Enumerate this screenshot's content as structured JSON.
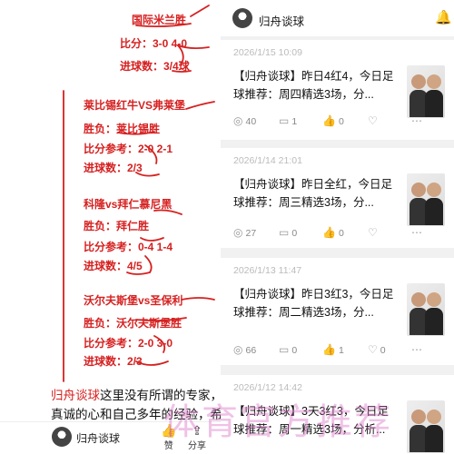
{
  "left": {
    "lines": [
      {
        "text": "国际米兰胜",
        "style": "red"
      },
      {
        "text": "比分：3-0 4-0",
        "style": "red"
      },
      {
        "text": "进球数：3/4球",
        "style": "red"
      },
      {
        "text": "莱比锡红牛VS弗莱堡",
        "style": "red"
      },
      {
        "text": "胜负：莱比锡胜",
        "style": "red"
      },
      {
        "text": "比分参考：2-0 2-1",
        "style": "red"
      },
      {
        "text": "进球数：2/3",
        "style": "red"
      },
      {
        "text": "科隆vs拜仁慕尼黑",
        "style": "red"
      },
      {
        "text": "胜负：拜仁胜",
        "style": "red"
      },
      {
        "text": "比分参考：0-4 1-4",
        "style": "red"
      },
      {
        "text": "进球数：4/5",
        "style": "red"
      },
      {
        "text": "沃尔夫斯堡vs圣保利",
        "style": "red"
      },
      {
        "text": "胜负：沃尔夫斯堡胜",
        "style": "red"
      },
      {
        "text": "比分参考：2-0 3-0",
        "style": "red"
      },
      {
        "text": "进球数：2/3",
        "style": "red"
      }
    ],
    "note_brand": "归舟谈球",
    "note_rest": "这里没有所谓的专家，真诚的心和自己多年的经验，希",
    "bottom_bar": {
      "author": "归舟谈球",
      "like_label": "赞",
      "share_label": "分享"
    }
  },
  "right": {
    "header_name": "归舟谈球",
    "cards": [
      {
        "date": "2026/1/15 10:09",
        "text": "【归舟谈球】昨日4红4，今日足球推荐：周四精选3场，分...",
        "views": "40",
        "comments": "1",
        "likes": "0",
        "shares": ""
      },
      {
        "date": "2026/1/14 21:01",
        "text": "【归舟谈球】昨日全红，今日足球推荐：周三精选3场，分...",
        "views": "27",
        "comments": "0",
        "likes": "0",
        "shares": ""
      },
      {
        "date": "2026/1/13 11:47",
        "text": "【归舟谈球】昨日3红3，今日足球推荐：周二精选3场，分...",
        "views": "66",
        "comments": "0",
        "likes": "1",
        "shares": "0"
      },
      {
        "date": "2026/1/12 14:42",
        "text": "【归舟谈球】3天3红3，今日足球推荐：周一精选3场，分析...",
        "views": "",
        "comments": "",
        "likes": "",
        "shares": ""
      }
    ]
  },
  "watermark": "体育官方推荐"
}
